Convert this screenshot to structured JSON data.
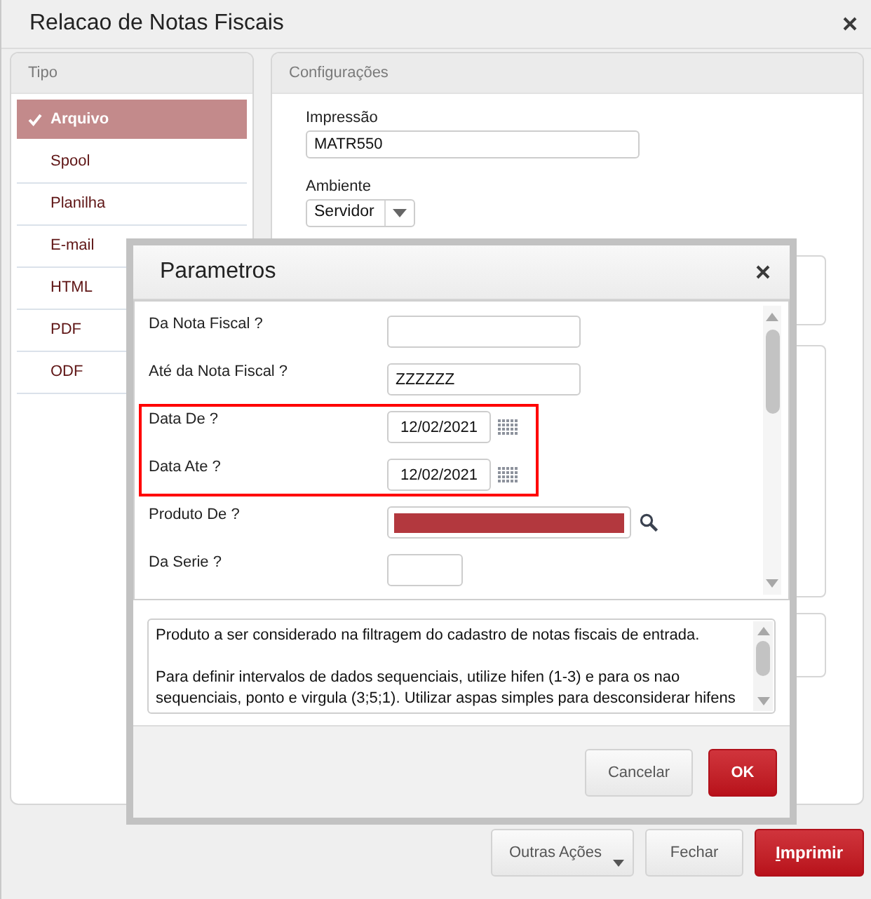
{
  "window": {
    "title": "Relacao de Notas Fiscais"
  },
  "type_panel": {
    "title": "Tipo",
    "items": [
      {
        "label": "Arquivo",
        "selected": true
      },
      {
        "label": "Spool",
        "selected": false
      },
      {
        "label": "Planilha",
        "selected": false
      },
      {
        "label": "E-mail",
        "selected": false
      },
      {
        "label": "HTML",
        "selected": false
      },
      {
        "label": "PDF",
        "selected": false
      },
      {
        "label": "ODF",
        "selected": false
      }
    ]
  },
  "config_panel": {
    "title": "Configurações",
    "fields": [
      {
        "label": "Impressão",
        "kind": "text",
        "value": "MATR550"
      },
      {
        "label": "Ambiente",
        "kind": "select",
        "value": "Servidor"
      }
    ]
  },
  "actions": [
    {
      "label": "Outras Ações",
      "kind": "menu",
      "mnemonic_underlined": false
    },
    {
      "label": "Fechar",
      "kind": "default",
      "mnemonic_underlined": false
    },
    {
      "label": "Imprimir",
      "kind": "primary",
      "mnemonic_underlined": true
    }
  ],
  "dialog": {
    "title": "Parametros",
    "params": [
      {
        "label": "Da Nota Fiscal ?",
        "kind": "text",
        "highlighted": false
      },
      {
        "label": "Até da Nota Fiscal ?",
        "kind": "text",
        "value": "ZZZZZZ",
        "highlighted": false
      },
      {
        "label": "Data De ?",
        "kind": "date",
        "value": "12/02/2021",
        "highlighted": true
      },
      {
        "label": "Data Ate ?",
        "kind": "date",
        "value": "12/02/2021",
        "highlighted": true
      },
      {
        "label": "Produto De ?",
        "kind": "lookup",
        "redacted": true,
        "highlighted": false
      },
      {
        "label": "Da Serie ?",
        "kind": "short",
        "highlighted": false
      }
    ],
    "help_text": [
      "Produto a ser considerado na filtragem do cadastro de notas fiscais de entrada.",
      "Para definir intervalos de dados sequenciais, utilize hifen (1-3) e para os nao sequenciais, ponto e virgula (3;5;1). Utilizar aspas simples para desconsiderar hifens"
    ],
    "buttons": [
      {
        "label": "Cancelar",
        "kind": "default"
      },
      {
        "label": "OK",
        "kind": "primary"
      }
    ]
  }
}
